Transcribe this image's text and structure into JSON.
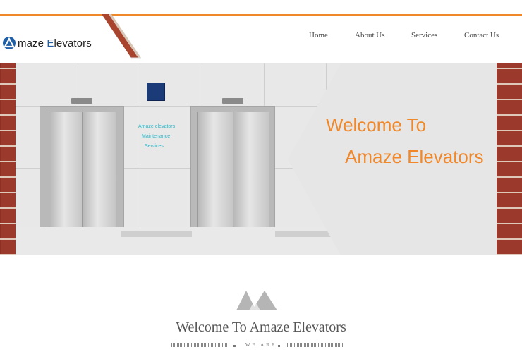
{
  "brand": {
    "logo_text_prefix": "maze ",
    "logo_text_E": "E",
    "logo_text_suffix": "levators",
    "accent_color": "#f0882a",
    "logo_color": "#1f5fa6"
  },
  "nav": {
    "items": [
      {
        "label": "Home"
      },
      {
        "label": "About Us"
      },
      {
        "label": "Services"
      },
      {
        "label": "Contact Us"
      }
    ]
  },
  "hero": {
    "wall_text": [
      "Amaze elevators",
      "Maintenance",
      "Services"
    ],
    "headline_line1": "Welcome  To",
    "headline_line2": "Amaze Elevators"
  },
  "welcome": {
    "title": "Welcome To Amaze Elevators",
    "subtitle": "WE ARE",
    "icon": "mountains-icon"
  }
}
